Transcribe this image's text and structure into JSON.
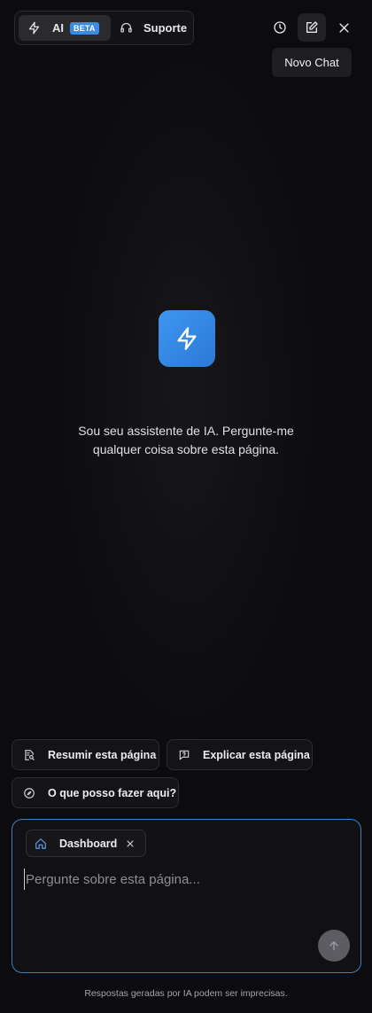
{
  "header": {
    "tabs": [
      {
        "label": "AI",
        "badge": "BETA",
        "icon": "bolt-icon",
        "active": true
      },
      {
        "label": "Suporte",
        "icon": "headset-icon",
        "active": false
      }
    ],
    "actions": [
      {
        "name": "history",
        "icon": "clock-icon"
      },
      {
        "name": "new-chat",
        "icon": "edit-icon",
        "tooltip": "Novo Chat"
      },
      {
        "name": "close",
        "icon": "close-icon"
      }
    ]
  },
  "empty_state": {
    "icon": "bolt-icon",
    "message": "Sou seu assistente de IA. Pergunte-me qualquer coisa sobre esta página."
  },
  "suggestions": [
    {
      "label": "Resumir esta página",
      "icon": "doc-search-icon"
    },
    {
      "label": "Explicar esta página",
      "icon": "chat-question-icon"
    },
    {
      "label": "O que posso fazer aqui?",
      "icon": "compass-icon"
    }
  ],
  "composer": {
    "context": {
      "label": "Dashboard",
      "icon": "home-icon"
    },
    "placeholder": "Pergunte sobre esta página...",
    "value": ""
  },
  "footer": {
    "disclaimer": "Respostas geradas por IA podem ser imprecisas."
  },
  "colors": {
    "accent": "#3b8be0",
    "background": "#0c0c0e",
    "composer_border": "#3d7fbf"
  }
}
